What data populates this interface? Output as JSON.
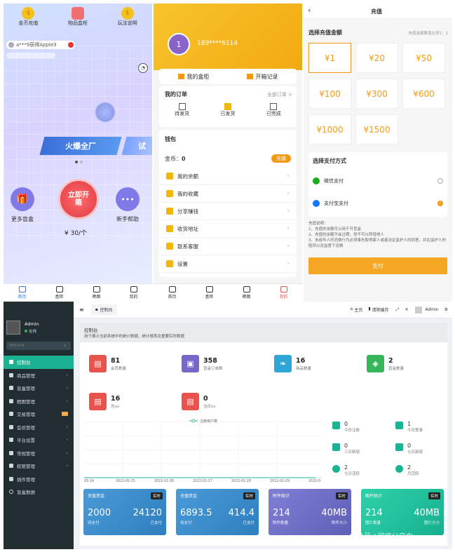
{
  "mobile_home": {
    "top_icons": [
      {
        "label": "金币充值"
      },
      {
        "label": "物品盒柜"
      },
      {
        "label": "玩法说明"
      }
    ],
    "ticker": "a***9获得Apple3",
    "banner_title": "火爆全厂",
    "banner_peek": "试",
    "side_left": "更多盲盒",
    "center_button": "立即开箱",
    "price": "¥ 30/个",
    "side_right": "新手帮助",
    "tabs": [
      "首页",
      "盒柜",
      "晒图",
      "我的"
    ]
  },
  "mobile_profile": {
    "level": "1",
    "phone": "189****6114",
    "top_links": [
      "我的盒柜",
      "开箱记录"
    ],
    "orders_title": "我的订单",
    "orders_all": "全部订单 >",
    "order_states": [
      "待发货",
      "已发货",
      "已完成"
    ],
    "wallet_title": "钱包",
    "coins_label": "金币：",
    "coins_value": "0",
    "recharge_btn": "充值",
    "menu": [
      "我的余额",
      "我的收藏",
      "分享赚钱",
      "收货地址",
      "联系客服",
      "设置"
    ],
    "tabs": [
      "首页",
      "盒柜",
      "晒图",
      "我的"
    ]
  },
  "mobile_recharge": {
    "title": "充值",
    "choose_amount": "选择充值金额",
    "ratio_note": "充值金额数值比例1：1",
    "amounts": [
      "¥1",
      "¥20",
      "¥50",
      "¥100",
      "¥300",
      "¥600",
      "¥1000",
      "¥1500"
    ],
    "choose_payment": "选择支付方式",
    "payments": [
      {
        "label": "微信支付",
        "selected": false
      },
      {
        "label": "支付宝支付",
        "selected": true
      }
    ],
    "notes_title": "充值说明：",
    "notes": [
      "1、充值的余额可以用于开盲盒",
      "2、充值的余额不会过期，但不可以转增他人",
      "3、未成年人的消费行为必须事先取得家人或者法定监护人的同意，并在监护人的陪同以及监督下消费"
    ],
    "pay_button": "支付"
  },
  "admin": {
    "user_name": "Admin",
    "user_status": "在线",
    "search_placeholder": "搜索菜单",
    "menu": [
      {
        "label": "控制台",
        "active": true,
        "badge": ""
      },
      {
        "label": "商品管理",
        "active": false,
        "badge": ""
      },
      {
        "label": "盲盒管理",
        "active": false,
        "badge": ""
      },
      {
        "label": "晒图管理",
        "active": false,
        "badge": ""
      },
      {
        "label": "交易管理",
        "active": false,
        "badge": "■"
      },
      {
        "label": "会员管理",
        "active": false,
        "badge": ""
      },
      {
        "label": "平台设置",
        "active": false,
        "badge": ""
      },
      {
        "label": "常规管理",
        "active": false,
        "badge": ""
      },
      {
        "label": "权限管理",
        "active": false,
        "badge": ""
      },
      {
        "label": "插件管理",
        "active": false,
        "badge": ""
      },
      {
        "label": "盲盒数据",
        "active": false,
        "badge": ""
      }
    ],
    "topbar_tab": "控制台",
    "topbar_links": [
      "主页",
      "清除缓存"
    ],
    "topbar_user": "Admin",
    "page_title": "控制台",
    "page_subtitle": "用于展示当前系统中的统计数据、统计报表及重要实时数据",
    "stats": [
      {
        "value": "81",
        "label": "会员数量",
        "color": "#e8534e"
      },
      {
        "value": "358",
        "label": "盲盒订单数",
        "color": "#7568c9"
      },
      {
        "value": "16",
        "label": "商品数量",
        "color": "#2fa6d8"
      },
      {
        "value": "2",
        "label": "盲盒数量",
        "color": "#35b65a"
      },
      {
        "value": "16",
        "label": "总uv",
        "color": "#e8534e"
      },
      {
        "value": "0",
        "label": "当日uv",
        "color": "#e8534e"
      }
    ],
    "chart_legend": "注册用户数",
    "chart_x": [
      "03-24",
      "2022-02-25",
      "2022-02-26",
      "2022-02-27",
      "2022-02-28",
      "2022-02-29",
      "2022-0"
    ],
    "mini_stats": [
      {
        "value": "0",
        "label": "今日注册",
        "color": "#1bb394"
      },
      {
        "value": "1",
        "label": "今日登录",
        "color": "#1bb394"
      },
      {
        "value": "0",
        "label": "三日新增",
        "color": "#1bb394"
      },
      {
        "value": "0",
        "label": "七日新增",
        "color": "#1bb394"
      },
      {
        "value": "2",
        "label": "七日活跃",
        "color": "#1bb394"
      },
      {
        "value": "2",
        "label": "月活跃",
        "color": "#1bb394"
      }
    ],
    "cards": [
      {
        "title": "充值资金",
        "badge": "实时",
        "v1": "2000",
        "v2": "24120",
        "l1": "待支付",
        "l2": "已支付",
        "color": "#3f8fd0"
      },
      {
        "title": "充值资金",
        "badge": "实时",
        "v1": "6893.5",
        "v2": "414.4",
        "l1": "待支付",
        "l2": "已支付",
        "color": "#3f8fd0"
      },
      {
        "title": "附件统计",
        "badge": "实时",
        "v1": "214",
        "v2": "40MB",
        "l1": "附件数量",
        "l2": "附件大小",
        "color": "#6b6fc9"
      },
      {
        "title": "图片统计",
        "badge": "实时",
        "v1": "214",
        "v2": "40MB",
        "l1": "图片数量",
        "l2": "图片大小",
        "color": "#1fc3a0"
      }
    ],
    "watermark": "头条号 / 网络分享中"
  }
}
